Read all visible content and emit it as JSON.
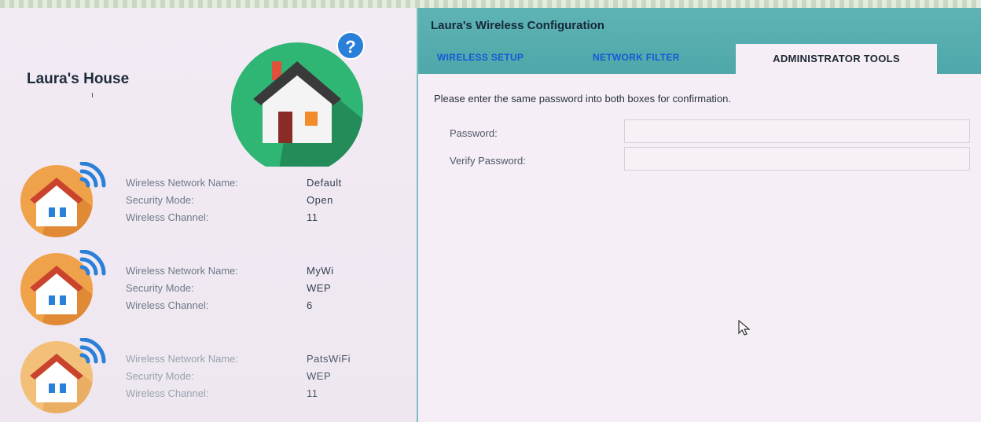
{
  "left": {
    "house_name": "Laura's House",
    "help_label": "?",
    "networks": [
      {
        "name_label": "Wireless Network Name:",
        "name_value": "Default",
        "security_label": "Security Mode:",
        "security_value": "Open",
        "channel_label": "Wireless Channel:",
        "channel_value": "11"
      },
      {
        "name_label": "Wireless Network Name:",
        "name_value": "MyWi",
        "security_label": "Security Mode:",
        "security_value": "WEP",
        "channel_label": "Wireless Channel:",
        "channel_value": "6"
      },
      {
        "name_label": "Wireless Network Name:",
        "name_value": "PatsWiFi",
        "security_label": "Security Mode:",
        "security_value": "WEP",
        "channel_label": "Wireless Channel:",
        "channel_value": "11"
      }
    ]
  },
  "config": {
    "title": "Laura's Wireless Configuration",
    "tabs": [
      {
        "label": "WIRELESS SETUP",
        "active": false
      },
      {
        "label": "NETWORK FILTER",
        "active": false
      },
      {
        "label": "ADMINISTRATOR TOOLS",
        "active": true
      }
    ],
    "instructions": "Please enter the same password into both boxes for confirmation.",
    "password_label": "Password:",
    "password_value": "",
    "verify_label": "Verify Password:",
    "verify_value": ""
  },
  "colors": {
    "header_teal": "#5fb3b4",
    "tab_link_blue": "#1857d8",
    "house_green": "#2fb574",
    "network_orange": "#f0a24a",
    "wifi_blue": "#2a7fd8"
  },
  "icons": [
    "house-icon",
    "help-icon",
    "network-house-icon",
    "wifi-icon",
    "mouse-cursor-icon"
  ]
}
